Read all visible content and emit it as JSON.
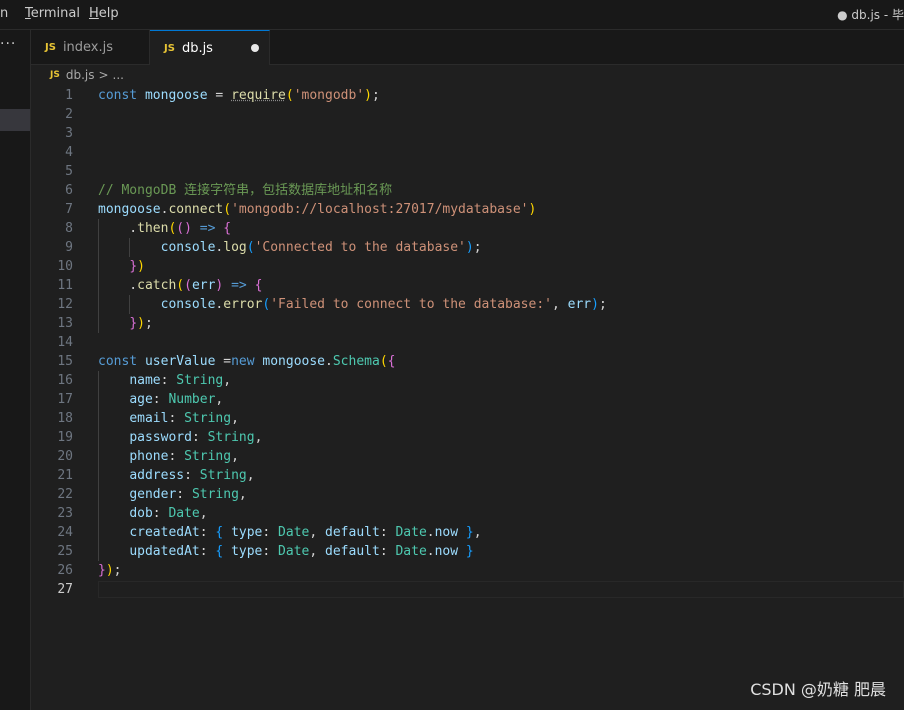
{
  "menu": {
    "partial": "n",
    "terminal_underlined": "T",
    "terminal_rest": "erminal",
    "help_underlined": "H",
    "help_rest": "elp"
  },
  "window_title": "● db.js - 毕",
  "sidebar": {
    "more_label": "···"
  },
  "tabs": [
    {
      "icon": "JS",
      "label": "index.js"
    },
    {
      "icon": "JS",
      "label": "db.js"
    }
  ],
  "breadcrumb": {
    "icon": "JS",
    "file": "db.js",
    "separator": ">",
    "rest": "..."
  },
  "editor": {
    "current_line": 27,
    "lines": [
      {
        "n": 1,
        "tokens": [
          [
            "kw",
            "const"
          ],
          [
            "",
            "␠"
          ],
          [
            "var",
            "mongoose"
          ],
          [
            "",
            " = "
          ],
          [
            "fn squig",
            "require"
          ],
          [
            "p1",
            "("
          ],
          [
            "str",
            "'mongodb'"
          ],
          [
            "p1",
            ")"
          ],
          [
            "",
            ";"
          ]
        ]
      },
      {
        "n": 2,
        "tokens": []
      },
      {
        "n": 3,
        "tokens": []
      },
      {
        "n": 4,
        "tokens": []
      },
      {
        "n": 5,
        "tokens": []
      },
      {
        "n": 6,
        "tokens": [
          [
            "cmt",
            "// MongoDB 连接字符串，包括数据库地址和名称"
          ]
        ]
      },
      {
        "n": 7,
        "tokens": [
          [
            "var",
            "mongoose"
          ],
          [
            "",
            "."
          ],
          [
            "fn",
            "connect"
          ],
          [
            "p1",
            "("
          ],
          [
            "str",
            "'mongodb://localhost:27017/mydatabase'"
          ],
          [
            "p1",
            ")"
          ]
        ]
      },
      {
        "n": 8,
        "tokens": [
          [
            "",
            "    ."
          ],
          [
            "fn",
            "then"
          ],
          [
            "p1",
            "("
          ],
          [
            "p2",
            "()"
          ],
          [
            "",
            " "
          ],
          [
            "kw",
            "=>"
          ],
          [
            "",
            " "
          ],
          [
            "p2",
            "{"
          ]
        ]
      },
      {
        "n": 9,
        "tokens": [
          [
            "",
            "        "
          ],
          [
            "var",
            "console"
          ],
          [
            "",
            "."
          ],
          [
            "fn",
            "log"
          ],
          [
            "p3",
            "("
          ],
          [
            "str",
            "'Connected to the database'"
          ],
          [
            "p3",
            ")"
          ],
          [
            "",
            ";"
          ]
        ]
      },
      {
        "n": 10,
        "tokens": [
          [
            "",
            "    "
          ],
          [
            "p2",
            "}"
          ],
          [
            "p1",
            ")"
          ]
        ]
      },
      {
        "n": 11,
        "tokens": [
          [
            "",
            "    ."
          ],
          [
            "fn",
            "catch"
          ],
          [
            "p1",
            "("
          ],
          [
            "p2",
            "("
          ],
          [
            "var",
            "err"
          ],
          [
            "p2",
            ")"
          ],
          [
            "",
            " "
          ],
          [
            "kw",
            "=>"
          ],
          [
            "",
            " "
          ],
          [
            "p2",
            "{"
          ]
        ]
      },
      {
        "n": 12,
        "tokens": [
          [
            "",
            "        "
          ],
          [
            "var",
            "console"
          ],
          [
            "",
            "."
          ],
          [
            "fn",
            "error"
          ],
          [
            "p3",
            "("
          ],
          [
            "str",
            "'Failed to connect to the database:'"
          ],
          [
            "",
            ", "
          ],
          [
            "var",
            "err"
          ],
          [
            "p3",
            ")"
          ],
          [
            "",
            ";"
          ]
        ]
      },
      {
        "n": 13,
        "tokens": [
          [
            "",
            "    "
          ],
          [
            "p2",
            "}"
          ],
          [
            "p1",
            ")"
          ],
          [
            "",
            ";"
          ]
        ]
      },
      {
        "n": 14,
        "tokens": []
      },
      {
        "n": 15,
        "tokens": [
          [
            "kw",
            "const"
          ],
          [
            "",
            " "
          ],
          [
            "var",
            "userValue"
          ],
          [
            "",
            " ="
          ],
          [
            "kw",
            "new"
          ],
          [
            "",
            " "
          ],
          [
            "var",
            "mongoose"
          ],
          [
            "",
            "."
          ],
          [
            "typ",
            "Schema"
          ],
          [
            "p1",
            "("
          ],
          [
            "p2",
            "{"
          ]
        ]
      },
      {
        "n": 16,
        "tokens": [
          [
            "",
            "    "
          ],
          [
            "var",
            "name"
          ],
          [
            "",
            ": "
          ],
          [
            "typ",
            "String"
          ],
          [
            "",
            ","
          ]
        ]
      },
      {
        "n": 17,
        "tokens": [
          [
            "",
            "    "
          ],
          [
            "var",
            "age"
          ],
          [
            "",
            ": "
          ],
          [
            "typ",
            "Number"
          ],
          [
            "",
            ","
          ]
        ]
      },
      {
        "n": 18,
        "tokens": [
          [
            "",
            "    "
          ],
          [
            "var",
            "email"
          ],
          [
            "",
            ": "
          ],
          [
            "typ",
            "String"
          ],
          [
            "",
            ","
          ]
        ]
      },
      {
        "n": 19,
        "tokens": [
          [
            "",
            "    "
          ],
          [
            "var",
            "password"
          ],
          [
            "",
            ": "
          ],
          [
            "typ",
            "String"
          ],
          [
            "",
            ","
          ]
        ]
      },
      {
        "n": 20,
        "tokens": [
          [
            "",
            "    "
          ],
          [
            "var",
            "phone"
          ],
          [
            "",
            ": "
          ],
          [
            "typ",
            "String"
          ],
          [
            "",
            ","
          ]
        ]
      },
      {
        "n": 21,
        "tokens": [
          [
            "",
            "    "
          ],
          [
            "var",
            "address"
          ],
          [
            "",
            ": "
          ],
          [
            "typ",
            "String"
          ],
          [
            "",
            ","
          ]
        ]
      },
      {
        "n": 22,
        "tokens": [
          [
            "",
            "    "
          ],
          [
            "var",
            "gender"
          ],
          [
            "",
            ": "
          ],
          [
            "typ",
            "String"
          ],
          [
            "",
            ","
          ]
        ]
      },
      {
        "n": 23,
        "tokens": [
          [
            "",
            "    "
          ],
          [
            "var",
            "dob"
          ],
          [
            "",
            ": "
          ],
          [
            "typ",
            "Date"
          ],
          [
            "",
            ","
          ]
        ]
      },
      {
        "n": 24,
        "tokens": [
          [
            "",
            "    "
          ],
          [
            "var",
            "createdAt"
          ],
          [
            "",
            ": "
          ],
          [
            "p3",
            "{"
          ],
          [
            "",
            " "
          ],
          [
            "var",
            "type"
          ],
          [
            "",
            ": "
          ],
          [
            "typ",
            "Date"
          ],
          [
            "",
            ", "
          ],
          [
            "var",
            "default"
          ],
          [
            "",
            ": "
          ],
          [
            "typ",
            "Date"
          ],
          [
            "",
            "."
          ],
          [
            "var",
            "now"
          ],
          [
            "",
            " "
          ],
          [
            "p3",
            "}"
          ],
          [
            "",
            ","
          ]
        ]
      },
      {
        "n": 25,
        "tokens": [
          [
            "",
            "    "
          ],
          [
            "var",
            "updatedAt"
          ],
          [
            "",
            ": "
          ],
          [
            "p3",
            "{"
          ],
          [
            "",
            " "
          ],
          [
            "var",
            "type"
          ],
          [
            "",
            ": "
          ],
          [
            "typ",
            "Date"
          ],
          [
            "",
            ", "
          ],
          [
            "var",
            "default"
          ],
          [
            "",
            ": "
          ],
          [
            "typ",
            "Date"
          ],
          [
            "",
            "."
          ],
          [
            "var",
            "now"
          ],
          [
            "",
            " "
          ],
          [
            "p3",
            "}"
          ]
        ]
      },
      {
        "n": 26,
        "tokens": [
          [
            "p2",
            "}"
          ],
          [
            "p1",
            ")"
          ],
          [
            "",
            ";"
          ]
        ]
      },
      {
        "n": 27,
        "tokens": []
      }
    ]
  },
  "watermark": "CSDN @奶糖 肥晨"
}
